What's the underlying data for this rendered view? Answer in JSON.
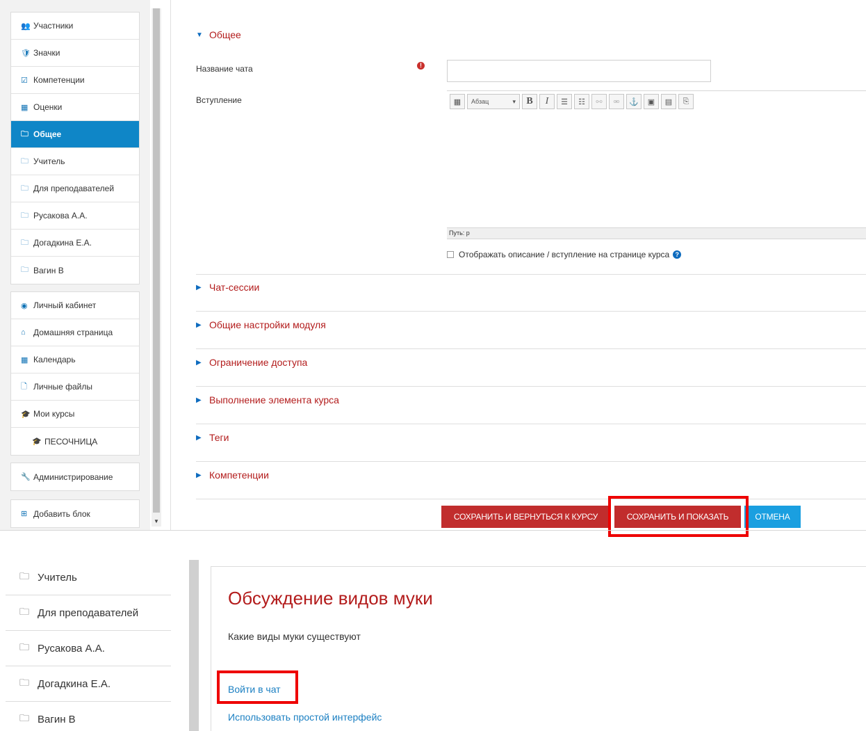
{
  "sidebar": {
    "block1": [
      {
        "icon": "users-icon",
        "glyph": "👥",
        "label": "Участники"
      },
      {
        "icon": "shield-icon",
        "glyph": "🛡",
        "label": "Значки"
      },
      {
        "icon": "checkbox-icon",
        "glyph": "☑",
        "label": "Компетенции"
      },
      {
        "icon": "table-icon",
        "glyph": "▦",
        "label": "Оценки"
      },
      {
        "icon": "folder-icon",
        "glyph": "🗀",
        "label": "Общее",
        "active": true
      },
      {
        "icon": "folder-icon",
        "glyph": "🗀",
        "label": "Учитель"
      },
      {
        "icon": "folder-icon",
        "glyph": "🗀",
        "label": "Для преподавателей"
      },
      {
        "icon": "folder-icon",
        "glyph": "🗀",
        "label": "Русакова А.А."
      },
      {
        "icon": "folder-icon",
        "glyph": "🗀",
        "label": "Догадкина Е.А."
      },
      {
        "icon": "folder-icon",
        "glyph": "🗀",
        "label": "Вагин В"
      }
    ],
    "block2": [
      {
        "icon": "dashboard-icon",
        "glyph": "◉",
        "label": "Личный кабинет"
      },
      {
        "icon": "home-icon",
        "glyph": "⌂",
        "label": "Домашняя страница"
      },
      {
        "icon": "calendar-icon",
        "glyph": "▦",
        "label": "Календарь"
      },
      {
        "icon": "file-icon",
        "glyph": "🗋",
        "label": "Личные файлы"
      },
      {
        "icon": "graduation-cap-icon",
        "glyph": "🎓",
        "label": "Мои курсы"
      },
      {
        "icon": "graduation-cap-icon",
        "glyph": "🎓",
        "label": "ПЕСОЧНИЦА",
        "indent": true
      }
    ],
    "admin": {
      "icon": "wrench-icon",
      "glyph": "🔧",
      "label": "Администрирование"
    },
    "add_block": {
      "icon": "plus-square-icon",
      "glyph": "⊞",
      "label": "Добавить блок"
    }
  },
  "form": {
    "general_section": "Общее",
    "chat_name_label": "Название чата",
    "chat_name_value": "",
    "intro_label": "Вступление",
    "editor": {
      "format_select": "Абзац",
      "path_label": "Путь: p"
    },
    "show_description_label": "Отображать описание / вступление на странице курса",
    "collapsed_sections": [
      "Чат-сессии",
      "Общие настройки модуля",
      "Ограничение доступа",
      "Выполнение элемента курса",
      "Теги",
      "Компетенции"
    ],
    "buttons": {
      "save_return": "СОХРАНИТЬ И ВЕРНУТЬСЯ К КУРСУ",
      "save_display": "СОХРАНИТЬ И ПОКАЗАТЬ",
      "cancel": "ОТМЕНА"
    },
    "colors": {
      "accent_red": "#c12d2d",
      "active_blue": "#0f86c7",
      "cancel_blue": "#1a9fe0",
      "highlight": "#ee0000"
    }
  },
  "bottom": {
    "sidebar": [
      {
        "icon": "folder-icon",
        "label": "Учитель"
      },
      {
        "icon": "folder-icon",
        "label": "Для преподавателей"
      },
      {
        "icon": "folder-icon",
        "label": "Русакова А.А."
      },
      {
        "icon": "folder-icon",
        "label": "Догадкина Е.А."
      },
      {
        "icon": "folder-icon",
        "label": "Вагин В"
      }
    ],
    "page_title": "Обсуждение видов муки",
    "intro_text": "Какие виды муки существуют",
    "enter_chat_link": "Войти в чат",
    "simple_interface_link": "Использовать простой интерфейс"
  }
}
